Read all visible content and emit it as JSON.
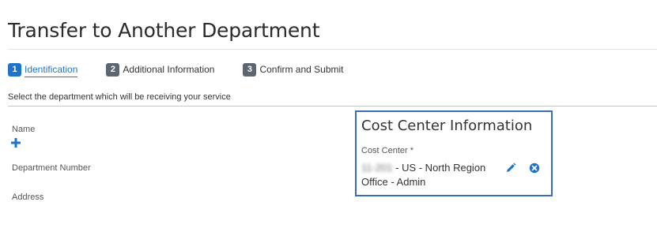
{
  "page": {
    "title": "Transfer to Another Department"
  },
  "steps": [
    {
      "number": "1",
      "label": "Identification",
      "state": "active"
    },
    {
      "number": "2",
      "label": "Additional Information",
      "state": "inactive"
    },
    {
      "number": "3",
      "label": "Confirm and Submit",
      "state": "inactive"
    }
  ],
  "instruction": "Select the department which will be receiving your service",
  "department": {
    "name_label": "Name",
    "add_icon": "plus-icon",
    "department_number_label": "Department Number",
    "address_label": "Address"
  },
  "cost_center": {
    "title": "Cost Center Information",
    "field_label": "Cost Center *",
    "value_code": "11-201",
    "value_text": " - US - North Region Office - Admin",
    "edit_icon": "pencil-icon",
    "remove_icon": "close-circle-icon"
  },
  "colors": {
    "accent": "#1f74c8",
    "panel_border": "#3b6db5",
    "inactive_step": "#5c6670"
  }
}
